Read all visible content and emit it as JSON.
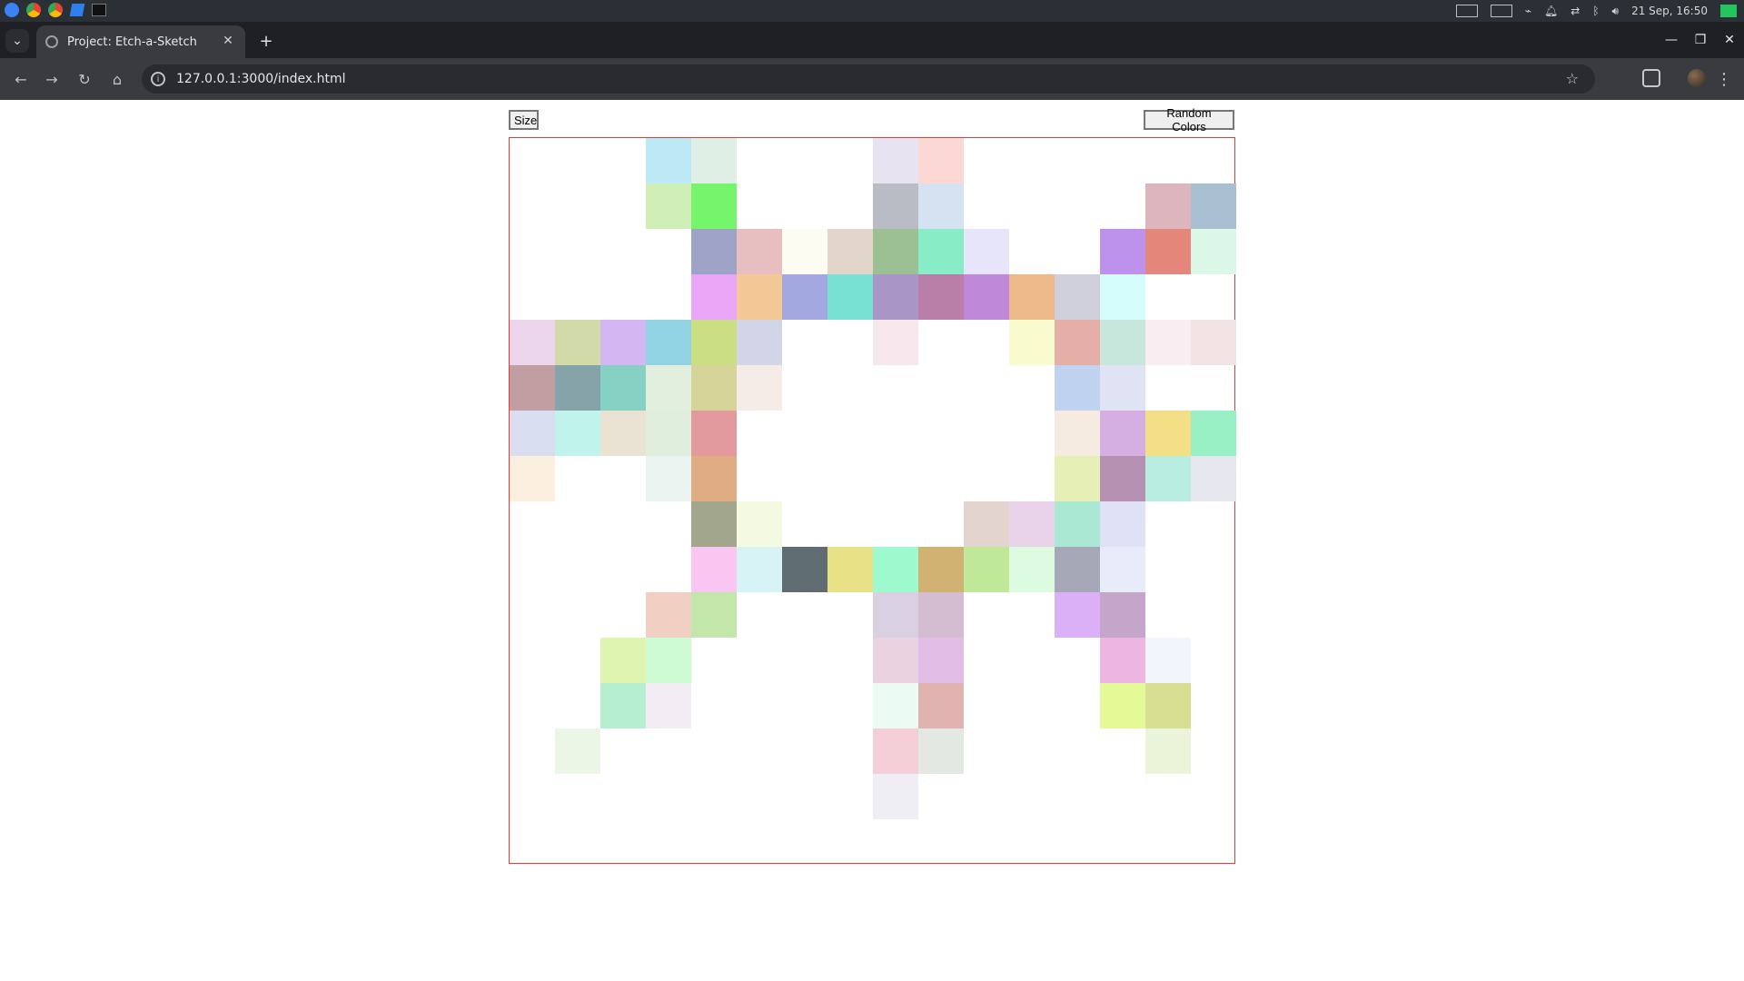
{
  "os": {
    "datetime": "21 Sep, 16:50",
    "apps": [
      "files-icon",
      "chrome-icon",
      "chrome-icon",
      "vscode-icon",
      "terminal-icon"
    ]
  },
  "browser": {
    "tab_title": "Project: Etch-a-Sketch",
    "url": "127.0.0.1:3000/index.html"
  },
  "page": {
    "size_button": "Size",
    "random_colors_button": "Random Colors",
    "grid": {
      "rows": 16,
      "cols": 16,
      "border_color": "#e53935",
      "filled_cells": [
        {
          "r": 0,
          "c": 3,
          "color": "#bde8f6"
        },
        {
          "r": 0,
          "c": 4,
          "color": "#e0efe6"
        },
        {
          "r": 0,
          "c": 8,
          "color": "#e7e3f1"
        },
        {
          "r": 0,
          "c": 9,
          "color": "#fcd8d4"
        },
        {
          "r": 1,
          "c": 3,
          "color": "#cfeeb5"
        },
        {
          "r": 1,
          "c": 4,
          "color": "#74f56b"
        },
        {
          "r": 1,
          "c": 8,
          "color": "#b9bcc5"
        },
        {
          "r": 1,
          "c": 9,
          "color": "#d4e2f2"
        },
        {
          "r": 1,
          "c": 14,
          "color": "#dcb5bd"
        },
        {
          "r": 1,
          "c": 15,
          "color": "#a7bfd0"
        },
        {
          "r": 2,
          "c": 4,
          "color": "#a0a3c8"
        },
        {
          "r": 2,
          "c": 5,
          "color": "#e8bfc1"
        },
        {
          "r": 2,
          "c": 6,
          "color": "#fdfcf3"
        },
        {
          "r": 2,
          "c": 7,
          "color": "#e1d6c9"
        },
        {
          "r": 2,
          "c": 8,
          "color": "#9cbf93"
        },
        {
          "r": 2,
          "c": 9,
          "color": "#88edc6"
        },
        {
          "r": 2,
          "c": 10,
          "color": "#e6e5f9"
        },
        {
          "r": 2,
          "c": 13,
          "color": "#bd92ec"
        },
        {
          "r": 2,
          "c": 14,
          "color": "#e5867b"
        },
        {
          "r": 2,
          "c": 15,
          "color": "#dcf7e8"
        },
        {
          "r": 3,
          "c": 4,
          "color": "#e9a5f6"
        },
        {
          "r": 3,
          "c": 5,
          "color": "#f4c896"
        },
        {
          "r": 3,
          "c": 6,
          "color": "#a3a9e0"
        },
        {
          "r": 3,
          "c": 7,
          "color": "#79e0d4"
        },
        {
          "r": 3,
          "c": 8,
          "color": "#a996c6"
        },
        {
          "r": 3,
          "c": 9,
          "color": "#b97fa8"
        },
        {
          "r": 3,
          "c": 10,
          "color": "#c088d9"
        },
        {
          "r": 3,
          "c": 11,
          "color": "#efba8a"
        },
        {
          "r": 3,
          "c": 12,
          "color": "#d0d0dc"
        },
        {
          "r": 3,
          "c": 13,
          "color": "#d4fcfa"
        },
        {
          "r": 4,
          "c": 0,
          "color": "#ebd5eb"
        },
        {
          "r": 4,
          "c": 1,
          "color": "#d3daa9"
        },
        {
          "r": 4,
          "c": 2,
          "color": "#d4b6f3"
        },
        {
          "r": 4,
          "c": 3,
          "color": "#92d4e4"
        },
        {
          "r": 4,
          "c": 4,
          "color": "#cbdf82"
        },
        {
          "r": 4,
          "c": 5,
          "color": "#d2d5e8"
        },
        {
          "r": 4,
          "c": 8,
          "color": "#f7e8ee"
        },
        {
          "r": 4,
          "c": 11,
          "color": "#f9fbcf"
        },
        {
          "r": 4,
          "c": 12,
          "color": "#e5aea6"
        },
        {
          "r": 4,
          "c": 13,
          "color": "#c7e7dc"
        },
        {
          "r": 4,
          "c": 14,
          "color": "#f9edf2"
        },
        {
          "r": 4,
          "c": 15,
          "color": "#f2e4e4"
        },
        {
          "r": 5,
          "c": 0,
          "color": "#c19ea1"
        },
        {
          "r": 5,
          "c": 1,
          "color": "#87a3aa"
        },
        {
          "r": 5,
          "c": 2,
          "color": "#87d0c4"
        },
        {
          "r": 5,
          "c": 3,
          "color": "#e2efdf"
        },
        {
          "r": 5,
          "c": 4,
          "color": "#d7d49a"
        },
        {
          "r": 5,
          "c": 5,
          "color": "#f6ece7"
        },
        {
          "r": 5,
          "c": 12,
          "color": "#bfd2ef"
        },
        {
          "r": 5,
          "c": 13,
          "color": "#dfe3f3"
        },
        {
          "r": 6,
          "c": 0,
          "color": "#d8ddef"
        },
        {
          "r": 6,
          "c": 1,
          "color": "#c0f3ec"
        },
        {
          "r": 6,
          "c": 2,
          "color": "#eae2d3"
        },
        {
          "r": 6,
          "c": 3,
          "color": "#dfeedd"
        },
        {
          "r": 6,
          "c": 4,
          "color": "#e39a9e"
        },
        {
          "r": 6,
          "c": 12,
          "color": "#f5ebe1"
        },
        {
          "r": 6,
          "c": 13,
          "color": "#d5aee2"
        },
        {
          "r": 6,
          "c": 14,
          "color": "#f3df85"
        },
        {
          "r": 6,
          "c": 15,
          "color": "#9af0c5"
        },
        {
          "r": 7,
          "c": 0,
          "color": "#fbf0df"
        },
        {
          "r": 7,
          "c": 3,
          "color": "#ebf3f1"
        },
        {
          "r": 7,
          "c": 4,
          "color": "#e0ac84"
        },
        {
          "r": 7,
          "c": 12,
          "color": "#e6f0b6"
        },
        {
          "r": 7,
          "c": 13,
          "color": "#b590b0"
        },
        {
          "r": 7,
          "c": 14,
          "color": "#b9ede0"
        },
        {
          "r": 7,
          "c": 15,
          "color": "#e6e6ef"
        },
        {
          "r": 8,
          "c": 4,
          "color": "#a2a68d"
        },
        {
          "r": 8,
          "c": 5,
          "color": "#f3fae1"
        },
        {
          "r": 8,
          "c": 10,
          "color": "#e3d4d0"
        },
        {
          "r": 8,
          "c": 11,
          "color": "#e8d3e9"
        },
        {
          "r": 8,
          "c": 12,
          "color": "#abe8d4"
        },
        {
          "r": 8,
          "c": 13,
          "color": "#dfe1f7"
        },
        {
          "r": 9,
          "c": 4,
          "color": "#f8c6f0"
        },
        {
          "r": 9,
          "c": 5,
          "color": "#d7f3f6"
        },
        {
          "r": 9,
          "c": 6,
          "color": "#5f6c72"
        },
        {
          "r": 9,
          "c": 7,
          "color": "#e9e186"
        },
        {
          "r": 9,
          "c": 8,
          "color": "#9ff9ce"
        },
        {
          "r": 9,
          "c": 9,
          "color": "#d2b273"
        },
        {
          "r": 9,
          "c": 10,
          "color": "#bfe898"
        },
        {
          "r": 9,
          "c": 11,
          "color": "#dcfbe1"
        },
        {
          "r": 9,
          "c": 12,
          "color": "#a6a8b8"
        },
        {
          "r": 9,
          "c": 13,
          "color": "#e7ecf8"
        },
        {
          "r": 10,
          "c": 3,
          "color": "#f1cfc3"
        },
        {
          "r": 10,
          "c": 4,
          "color": "#c3e7aa"
        },
        {
          "r": 10,
          "c": 8,
          "color": "#d9d1e1"
        },
        {
          "r": 10,
          "c": 9,
          "color": "#d4bdd1"
        },
        {
          "r": 10,
          "c": 12,
          "color": "#dcb0f6"
        },
        {
          "r": 10,
          "c": 13,
          "color": "#c4a7c8"
        },
        {
          "r": 11,
          "c": 2,
          "color": "#def4b0"
        },
        {
          "r": 11,
          "c": 3,
          "color": "#cefbd2"
        },
        {
          "r": 11,
          "c": 8,
          "color": "#ebd2e0"
        },
        {
          "r": 11,
          "c": 9,
          "color": "#e1bde6"
        },
        {
          "r": 11,
          "c": 13,
          "color": "#ecb6e0"
        },
        {
          "r": 11,
          "c": 14,
          "color": "#f0f6fb"
        },
        {
          "r": 12,
          "c": 2,
          "color": "#b5eed1"
        },
        {
          "r": 12,
          "c": 3,
          "color": "#f2edf4"
        },
        {
          "r": 12,
          "c": 8,
          "color": "#ebfbf3"
        },
        {
          "r": 12,
          "c": 9,
          "color": "#e0b3b1"
        },
        {
          "r": 12,
          "c": 13,
          "color": "#e4fa97"
        },
        {
          "r": 12,
          "c": 14,
          "color": "#d6df92"
        },
        {
          "r": 13,
          "c": 1,
          "color": "#ebf6e6"
        },
        {
          "r": 13,
          "c": 8,
          "color": "#f5cfd8"
        },
        {
          "r": 13,
          "c": 9,
          "color": "#e3e9e2"
        },
        {
          "r": 13,
          "c": 14,
          "color": "#ebf3d8"
        },
        {
          "r": 14,
          "c": 8,
          "color": "#f0eef5"
        }
      ]
    }
  }
}
